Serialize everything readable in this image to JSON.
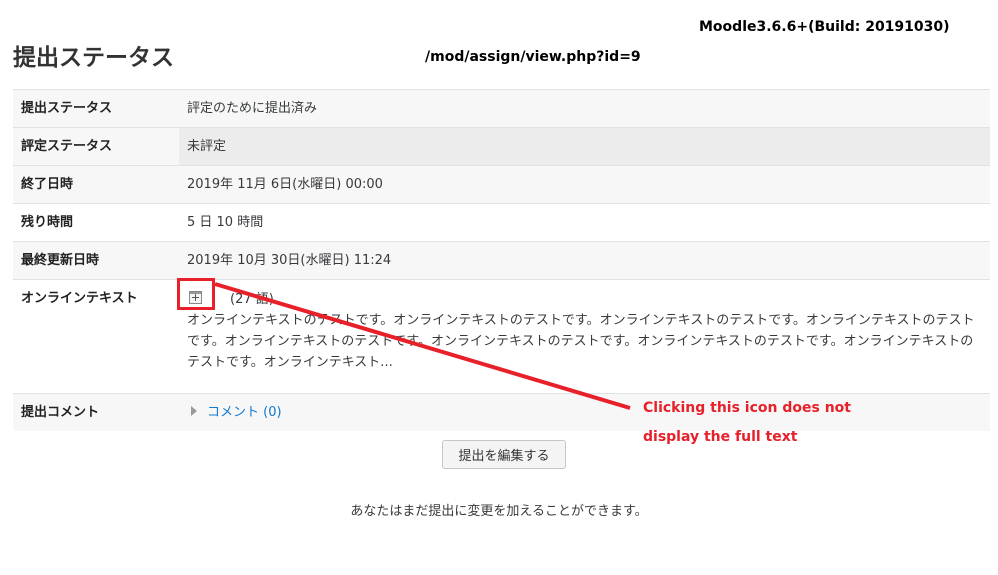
{
  "header": {
    "version": "Moodle3.6.6+(Build: 20191030)",
    "url": "/mod/assign/view.php?id=9",
    "title": "提出ステータス"
  },
  "status_table": {
    "submission_status": {
      "label": "提出ステータス",
      "value": "評定のために提出済み"
    },
    "grading_status": {
      "label": "評定ステータス",
      "value": "未評定"
    },
    "due_date": {
      "label": "終了日時",
      "value": "2019年 11月 6日(水曜日) 00:00"
    },
    "time_remaining": {
      "label": "残り時間",
      "value": "5 日 10 時間"
    },
    "last_modified": {
      "label": "最終更新日時",
      "value": "2019年 10月 30日(水曜日) 11:24"
    },
    "online_text": {
      "label": "オンラインテキスト",
      "word_count": "(27 語)",
      "text": "オンラインテキストのテストです。オンラインテキストのテストです。オンラインテキストのテストです。オンラインテキストのテストです。オンラインテキストのテストです。オンラインテキストのテストです。オンラインテキストのテストです。オンラインテキストのテストです。オンラインテキスト..."
    },
    "submission_comments": {
      "label": "提出コメント",
      "link": "コメント (0)"
    }
  },
  "edit_button": "提出を編集する",
  "note": "あなたはまだ提出に変更を加えることができます。",
  "annotation": {
    "line1": "Clicking this icon does not",
    "line2": "display the full text",
    "color": "#e8202a"
  },
  "icons": {
    "expand": "expand-text-icon",
    "caret": "caret-right-icon"
  }
}
